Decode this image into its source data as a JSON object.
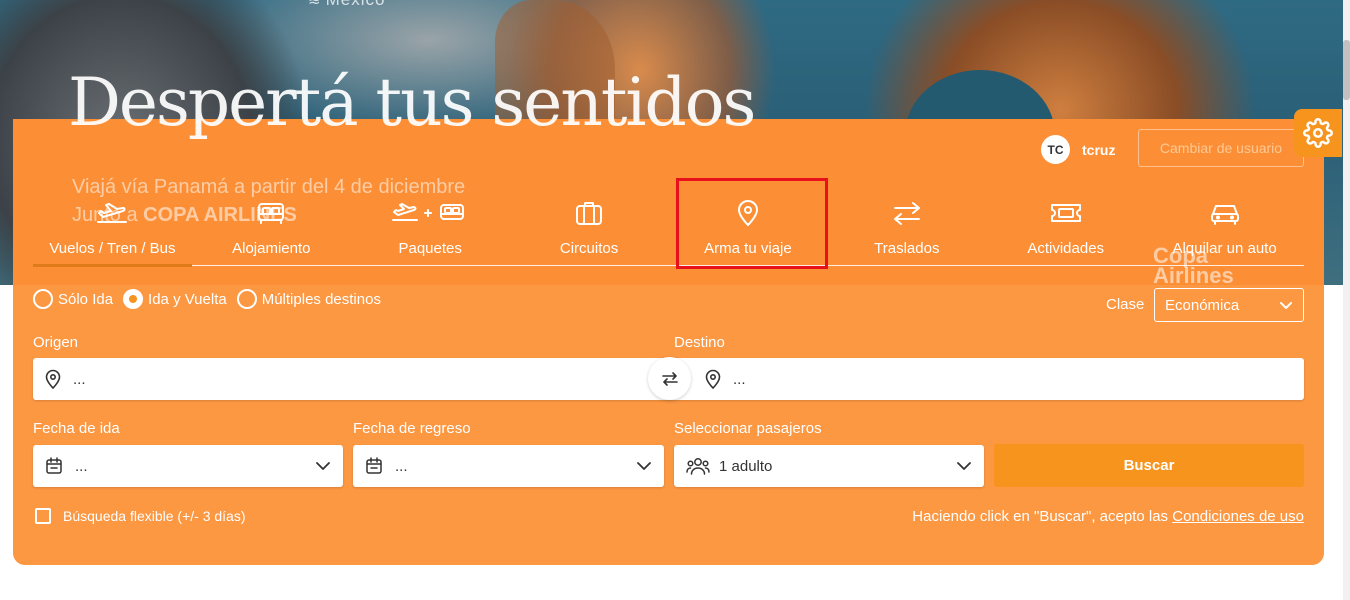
{
  "hero": {
    "brand_top": "Mexico",
    "headline": "Despertá tus sentidos",
    "sub_line1": "Viajá vía Panamá a partir del 4 de diciembre",
    "sub_line2_prefix": "Junto a ",
    "sub_line2_brand": "COPA AIRLINES",
    "partner_logo": "Copa Airlines"
  },
  "user": {
    "initials": "TC",
    "name": "tcruz",
    "change_label": "Cambiar de usuario"
  },
  "settings_icon": "gear-icon",
  "tabs": [
    {
      "label": "Vuelos / Tren / Bus",
      "icon": "plane-takeoff-icon",
      "active": true
    },
    {
      "label": "Alojamiento",
      "icon": "bed-icon",
      "active": false
    },
    {
      "label": "Paquetes",
      "icon": "plane-plus-bed-icon",
      "active": false
    },
    {
      "label": "Circuitos",
      "icon": "suitcase-icon",
      "active": false
    },
    {
      "label": "Arma tu viaje",
      "icon": "map-pin-icon",
      "active": false
    },
    {
      "label": "Traslados",
      "icon": "arrows-swap-icon",
      "active": false
    },
    {
      "label": "Actividades",
      "icon": "ticket-icon",
      "active": false
    },
    {
      "label": "Alquilar un auto",
      "icon": "car-icon",
      "active": false
    }
  ],
  "trip_types": [
    {
      "label": "Sólo Ida",
      "selected": false
    },
    {
      "label": "Ida y Vuelta",
      "selected": true
    },
    {
      "label": "Múltiples destinos",
      "selected": false
    }
  ],
  "class": {
    "label": "Clase",
    "value": "Económica"
  },
  "origin": {
    "label": "Origen",
    "value": "..."
  },
  "destination": {
    "label": "Destino",
    "value": "..."
  },
  "departure": {
    "label": "Fecha de ida",
    "value": "..."
  },
  "return": {
    "label": "Fecha de regreso",
    "value": "..."
  },
  "passengers": {
    "label": "Seleccionar pasajeros",
    "value": "1 adulto"
  },
  "search_button": "Buscar",
  "flexible": {
    "label": "Búsqueda flexible (+/- 3 días)",
    "checked": false
  },
  "terms": {
    "prefix": "Haciendo click en \"Buscar\", acepto las ",
    "link": "Condiciones de uso"
  },
  "colors": {
    "panel": "#fc9742",
    "button": "#f7941d",
    "highlight": "#e8101a"
  }
}
